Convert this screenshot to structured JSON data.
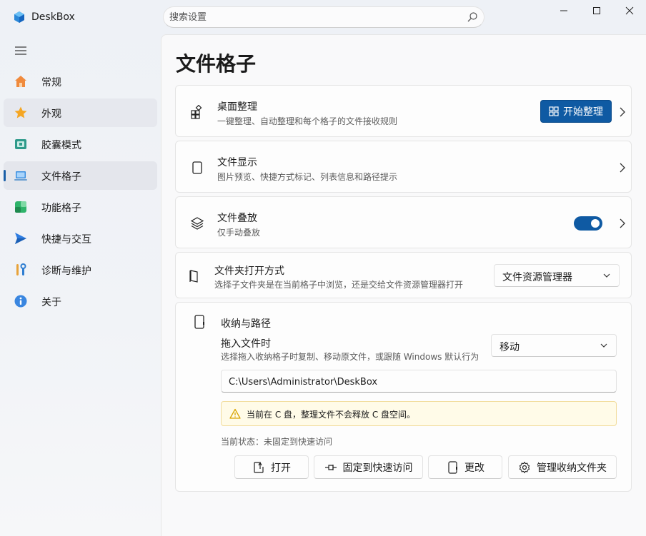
{
  "app": {
    "title": "DeskBox"
  },
  "search": {
    "placeholder": "搜索设置"
  },
  "window_controls": [
    "minimize",
    "maximize",
    "close"
  ],
  "sidebar": {
    "items": [
      {
        "label": "常规",
        "icon": "home-icon"
      },
      {
        "label": "外观",
        "icon": "star-icon"
      },
      {
        "label": "胶囊模式",
        "icon": "capsule-icon"
      },
      {
        "label": "文件格子",
        "icon": "laptop-icon"
      },
      {
        "label": "功能格子",
        "icon": "cube-icon"
      },
      {
        "label": "快捷与交互",
        "icon": "send-icon"
      },
      {
        "label": "诊断与维护",
        "icon": "tools-icon"
      },
      {
        "label": "关于",
        "icon": "info-icon"
      }
    ],
    "selected": "文件格子"
  },
  "page": {
    "title": "文件格子"
  },
  "cards": {
    "organize": {
      "title": "桌面整理",
      "desc": "一键整理、自动整理和每个格子的文件接收规则",
      "button": "开始整理"
    },
    "display": {
      "title": "文件显示",
      "desc": "图片预览、快捷方式标记、列表信息和路径提示"
    },
    "stack": {
      "title": "文件叠放",
      "desc": "仅手动叠放",
      "toggle_on": true
    },
    "folder_open": {
      "title": "文件夹打开方式",
      "desc": "选择子文件夹是在当前格子中浏览，还是交给文件资源管理器打开",
      "value": "文件资源管理器"
    },
    "storage": {
      "title": "收纳与路径",
      "drag_title": "拖入文件时",
      "drag_desc": "选择拖入收纳格子时复制、移动原文件，或跟随 Windows 默认行为",
      "drag_value": "移动",
      "path": "C:\\Users\\Administrator\\DeskBox",
      "warning": "当前在 C 盘，整理文件不会释放 C 盘空间。",
      "status": "当前状态：未固定到快速访问",
      "buttons": {
        "open": "打开",
        "pin": "固定到快速访问",
        "change": "更改",
        "manage": "管理收纳文件夹"
      }
    }
  },
  "colors": {
    "accent": "#0f5aa3",
    "warning_bg": "#fffbe8",
    "warning_icon": "#d9a400"
  }
}
